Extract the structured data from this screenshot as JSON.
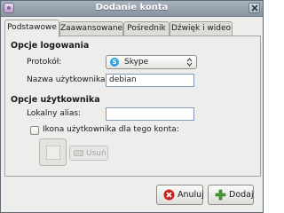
{
  "window": {
    "title": "Dodanie konta"
  },
  "tabs": [
    {
      "label": "Podstawowe",
      "active": true
    },
    {
      "label": "Zaawansowane",
      "active": false
    },
    {
      "label": "Pośrednik",
      "active": false
    },
    {
      "label": "Dźwięk i wideo",
      "active": false
    }
  ],
  "login_section": {
    "title": "Opcje logowania",
    "protocol_label": "Protokół:",
    "protocol_value": "Skype",
    "protocol_icon": "skype-icon",
    "username_label": "Nazwa użytkownika:",
    "username_value": "debian"
  },
  "user_section": {
    "title": "Opcje użytkownika",
    "alias_label": "Lokalny alias:",
    "alias_value": "",
    "icon_checkbox_label": "Ikona użytkownika dla tego konta:",
    "icon_checkbox_checked": false,
    "remove_button_label": "Usuń"
  },
  "buttons": {
    "cancel_label": "Anuluj",
    "add_label": "Dodaj"
  },
  "colors": {
    "cancel_icon": "#cc1f1f",
    "add_icon": "#3f9c2e",
    "accent": "#2aa2e3"
  }
}
